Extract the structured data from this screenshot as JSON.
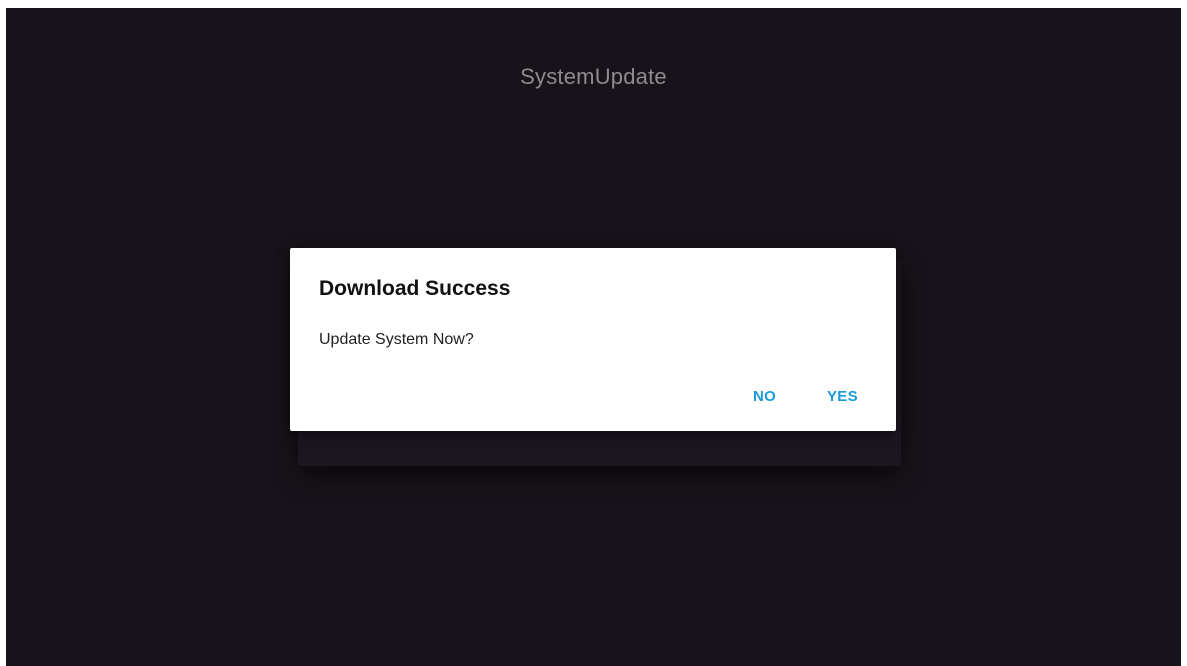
{
  "app": {
    "title": "SystemUpdate"
  },
  "dialog": {
    "title": "Download Success",
    "message": "Update System Now?",
    "buttons": {
      "no": "NO",
      "yes": "YES"
    }
  },
  "colors": {
    "background": "#17131a",
    "accent": "#1a9ad6",
    "dialog": "#ffffff"
  }
}
